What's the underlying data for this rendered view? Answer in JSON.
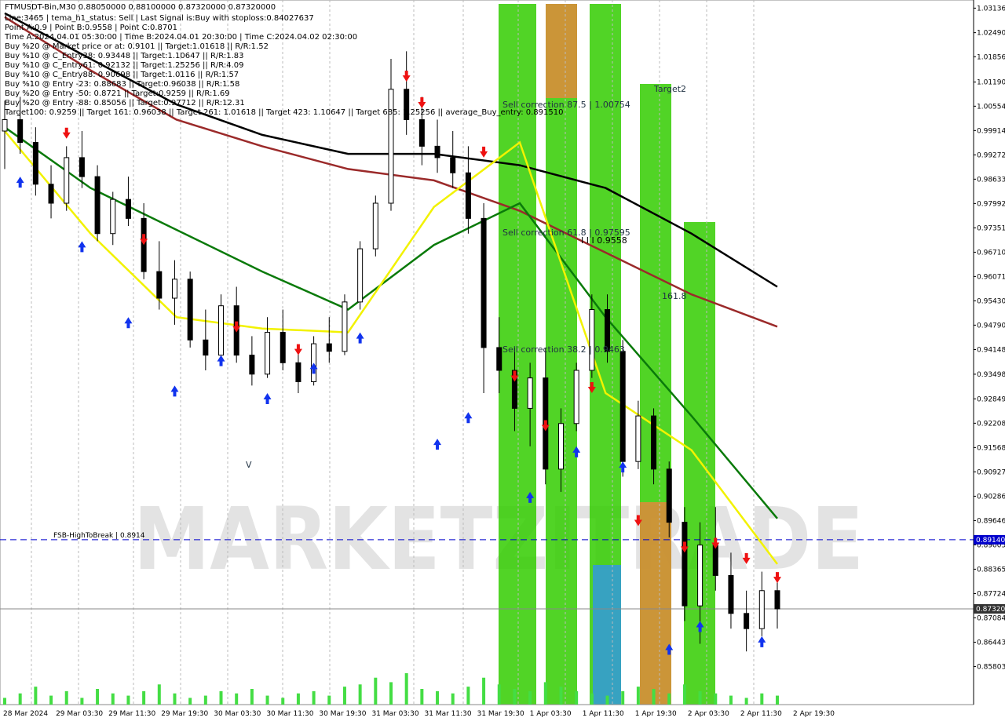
{
  "chart_data": {
    "type": "candlestick",
    "symbol_line": "FTMUSDT-Bin,M30  0.88050000 0.88100000 0.87320000 0.87320000",
    "info_lines": [
      "Line:3465 | tema_h1_status: Sell | Last Signal is:Buy with stoploss:0.84027637",
      "Point A:0.9 | Point B:0.9558 | Point C:0.8701",
      "Time A:2024.04.01 05:30:00 | Time B:2024.04.01 20:30:00 | Time C:2024.04.02 02:30:00",
      "Buy %20 @ Market price or at: 0.9101 || Target:1.01618 || R/R:1.52",
      "Buy %10 @ C_Entry38: 0.93448 || Target:1.10647 || R/R:1.83",
      "Buy %10 @ C_Entry61: 0.92132 || Target:1.25256 || R/R:4.09",
      "Buy %10 @ C_Entry88: 0.90698 || Target:1.0116 || R/R:1.57",
      "Buy %10 @ Entry -23: 0.88683 || Target:0.96038 || R/R:1.58",
      "Buy %20 @ Entry -50: 0.8721 || Target:0.9259 || R/R:1.69",
      "Buy %20 @ Entry -88: 0.85056 || Target:0.97712 || R/R:12.31",
      "Target100: 0.9259 || Target 161: 0.96038 || Target 261: 1.01618 || Target 423: 1.10647 || Target 685: 1.25256 || average_Buy_entry: 0.891510"
    ],
    "y_range": [
      0.848,
      1.0335
    ],
    "y_ticks": [
      "1.03136",
      "1.02490",
      "1.01856",
      "1.01190",
      "1.00554",
      "0.99914",
      "0.99272",
      "0.98633",
      "0.97992",
      "0.97351",
      "0.96710",
      "0.96071",
      "0.95430",
      "0.94790",
      "0.94148",
      "0.93498",
      "0.92849",
      "0.92208",
      "0.91568",
      "0.90927",
      "0.90286",
      "0.89646",
      "0.89005",
      "0.88365",
      "0.87724",
      "0.87084",
      "0.86443",
      "0.85803"
    ],
    "x_ticks": [
      "28 Mar 2024",
      "29 Mar 03:30",
      "29 Mar 11:30",
      "29 Mar 19:30",
      "30 Mar 03:30",
      "30 Mar 11:30",
      "30 Mar 19:30",
      "31 Mar 03:30",
      "31 Mar 11:30",
      "31 Mar 19:30",
      "1 Apr 03:30",
      "1 Apr 11:30",
      "1 Apr 19:30",
      "2 Apr 03:30",
      "2 Apr 11:30",
      "2 Apr 19:30"
    ],
    "hline_fsb": {
      "label": "FSB-HighToBreak  | 0.8914",
      "value": 0.8914,
      "badge": "0.89140"
    },
    "hline_price": {
      "value": 0.8732,
      "badge": "0.87320"
    },
    "zone_labels": [
      "Sell correction 87.5 | 1.00754",
      "Sell correction 61.8 | 0.97595",
      "Sell correction 38.2 | 0.9463",
      "Target2",
      "161.8",
      "I I I 0.9558",
      "V"
    ],
    "watermark": "MARKETZITRADE",
    "colors": {
      "up_bar": "#000000",
      "down_bar": "#000000",
      "green_zone": "#33cc00",
      "orange_zone": "#e08a3c",
      "blue_zone": "#3399dd",
      "ma_black": "#000000",
      "ma_brown": "#9b2a2a",
      "ma_green": "#0a7a0a",
      "ma_yellow": "#f2f200",
      "dashed_blue": "#0000cc",
      "sell_arrow": "#ee1111",
      "buy_arrow": "#1133ee",
      "channel": "#ff4400"
    },
    "ma_series": [
      {
        "color_key": "ma_black",
        "values": [
          1.03,
          1.018,
          1.006,
          0.998,
          0.993,
          0.993,
          0.99,
          0.984,
          0.972,
          0.958
        ]
      },
      {
        "color_key": "ma_brown",
        "values": [
          1.029,
          1.015,
          1.002,
          0.995,
          0.989,
          0.986,
          0.978,
          0.967,
          0.956,
          0.9475
        ]
      },
      {
        "color_key": "ma_green",
        "values": [
          1.0,
          0.984,
          0.973,
          0.962,
          0.952,
          0.969,
          0.98,
          0.95,
          0.924,
          0.897
        ]
      },
      {
        "color_key": "ma_yellow",
        "values": [
          0.999,
          0.972,
          0.95,
          0.947,
          0.946,
          0.979,
          0.996,
          0.93,
          0.915,
          0.885
        ]
      }
    ],
    "candles": [
      [
        0.999,
        1.007,
        0.989,
        1.002
      ],
      [
        1.002,
        1.008,
        0.993,
        0.996
      ],
      [
        0.996,
        1.0,
        0.982,
        0.985
      ],
      [
        0.985,
        0.99,
        0.976,
        0.98
      ],
      [
        0.98,
        0.995,
        0.978,
        0.992
      ],
      [
        0.992,
        0.999,
        0.984,
        0.987
      ],
      [
        0.987,
        0.99,
        0.97,
        0.972
      ],
      [
        0.972,
        0.983,
        0.969,
        0.981
      ],
      [
        0.981,
        0.987,
        0.974,
        0.976
      ],
      [
        0.976,
        0.98,
        0.96,
        0.962
      ],
      [
        0.962,
        0.97,
        0.952,
        0.955
      ],
      [
        0.955,
        0.965,
        0.948,
        0.96
      ],
      [
        0.96,
        0.962,
        0.942,
        0.944
      ],
      [
        0.944,
        0.952,
        0.936,
        0.94
      ],
      [
        0.94,
        0.956,
        0.938,
        0.953
      ],
      [
        0.953,
        0.958,
        0.938,
        0.94
      ],
      [
        0.94,
        0.945,
        0.932,
        0.935
      ],
      [
        0.935,
        0.95,
        0.934,
        0.946
      ],
      [
        0.946,
        0.952,
        0.936,
        0.938
      ],
      [
        0.938,
        0.942,
        0.93,
        0.933
      ],
      [
        0.933,
        0.945,
        0.932,
        0.943
      ],
      [
        0.943,
        0.95,
        0.938,
        0.941
      ],
      [
        0.941,
        0.956,
        0.94,
        0.954
      ],
      [
        0.954,
        0.97,
        0.952,
        0.968
      ],
      [
        0.968,
        0.982,
        0.966,
        0.98
      ],
      [
        0.98,
        1.018,
        0.978,
        1.01
      ],
      [
        1.01,
        1.02,
        0.998,
        1.002
      ],
      [
        1.002,
        1.008,
        0.99,
        0.995
      ],
      [
        0.995,
        1.002,
        0.988,
        0.992
      ],
      [
        0.992,
        0.999,
        0.984,
        0.988
      ],
      [
        0.988,
        0.995,
        0.972,
        0.976
      ],
      [
        0.976,
        0.98,
        0.93,
        0.942
      ],
      [
        0.942,
        0.95,
        0.93,
        0.936
      ],
      [
        0.936,
        0.942,
        0.92,
        0.926
      ],
      [
        0.926,
        0.938,
        0.916,
        0.934
      ],
      [
        0.934,
        0.942,
        0.906,
        0.91
      ],
      [
        0.91,
        0.926,
        0.904,
        0.922
      ],
      [
        0.922,
        0.938,
        0.92,
        0.936
      ],
      [
        0.936,
        0.956,
        0.934,
        0.952
      ],
      [
        0.952,
        0.956,
        0.938,
        0.941
      ],
      [
        0.941,
        0.944,
        0.908,
        0.912
      ],
      [
        0.912,
        0.928,
        0.91,
        0.924
      ],
      [
        0.924,
        0.926,
        0.906,
        0.91
      ],
      [
        0.91,
        0.912,
        0.892,
        0.896
      ],
      [
        0.896,
        0.9,
        0.87,
        0.874
      ],
      [
        0.874,
        0.896,
        0.864,
        0.89
      ],
      [
        0.89,
        0.9,
        0.878,
        0.882
      ],
      [
        0.882,
        0.888,
        0.868,
        0.872
      ],
      [
        0.872,
        0.878,
        0.862,
        0.868
      ],
      [
        0.868,
        0.883,
        0.866,
        0.878
      ],
      [
        0.878,
        0.882,
        0.868,
        0.8732
      ]
    ],
    "volumes": [
      3,
      5,
      8,
      4,
      6,
      3,
      7,
      5,
      4,
      6,
      9,
      5,
      3,
      4,
      6,
      5,
      7,
      4,
      3,
      5,
      6,
      4,
      8,
      9,
      12,
      10,
      14,
      7,
      6,
      5,
      8,
      12,
      9,
      7,
      6,
      10,
      8,
      6,
      5,
      4,
      6,
      8,
      7,
      5,
      9,
      6,
      5,
      4,
      3,
      5,
      4
    ],
    "sell_arrows": [
      [
        4,
        0.997
      ],
      [
        9,
        0.969
      ],
      [
        15,
        0.946
      ],
      [
        19,
        0.94
      ],
      [
        26,
        1.012
      ],
      [
        27,
        1.005
      ],
      [
        31,
        0.992
      ],
      [
        33,
        0.933
      ],
      [
        35,
        0.92
      ],
      [
        38,
        0.93
      ],
      [
        41,
        0.895
      ],
      [
        44,
        0.888
      ],
      [
        46,
        0.889
      ],
      [
        48,
        0.885
      ],
      [
        50,
        0.88
      ]
    ],
    "buy_arrows": [
      [
        1,
        0.987
      ],
      [
        5,
        0.97
      ],
      [
        8,
        0.95
      ],
      [
        11,
        0.932
      ],
      [
        14,
        0.94
      ],
      [
        17,
        0.93
      ],
      [
        20,
        0.938
      ],
      [
        23,
        0.946
      ],
      [
        28,
        0.918
      ],
      [
        30,
        0.925
      ],
      [
        34,
        0.904
      ],
      [
        37,
        0.916
      ],
      [
        40,
        0.912
      ],
      [
        43,
        0.864
      ],
      [
        45,
        0.87
      ],
      [
        49,
        0.866
      ]
    ]
  }
}
